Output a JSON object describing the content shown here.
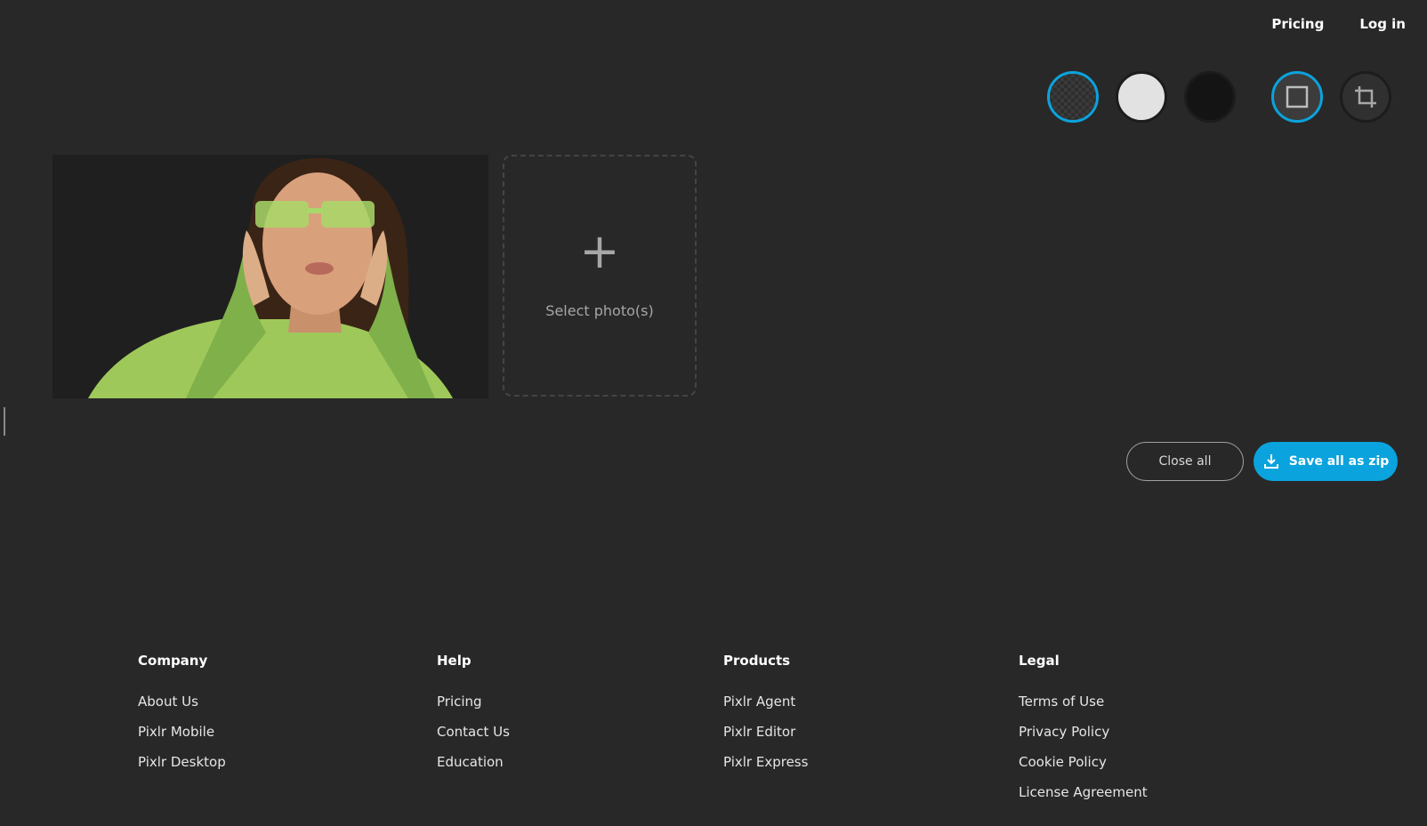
{
  "nav": {
    "pricing": "Pricing",
    "login": "Log in"
  },
  "toolbar": {
    "background_options": [
      "transparent",
      "white",
      "black"
    ],
    "selected_background": "transparent",
    "shape_options": [
      "square",
      "crop"
    ],
    "selected_shape": "square",
    "accent_color": "#0ba3dd"
  },
  "uploader": {
    "select_label": "Select photo(s)"
  },
  "actions": {
    "close_all": "Close all",
    "save_zip": "Save all as zip"
  },
  "footer": {
    "company": {
      "title": "Company",
      "links": [
        "About Us",
        "Pixlr Mobile",
        "Pixlr Desktop"
      ]
    },
    "help": {
      "title": "Help",
      "links": [
        "Pricing",
        "Contact Us",
        "Education"
      ]
    },
    "products": {
      "title": "Products",
      "links": [
        "Pixlr Agent",
        "Pixlr Editor",
        "Pixlr Express"
      ]
    },
    "legal": {
      "title": "Legal",
      "links": [
        "Terms of Use",
        "Privacy Policy",
        "Cookie Policy",
        "License Agreement"
      ]
    }
  }
}
